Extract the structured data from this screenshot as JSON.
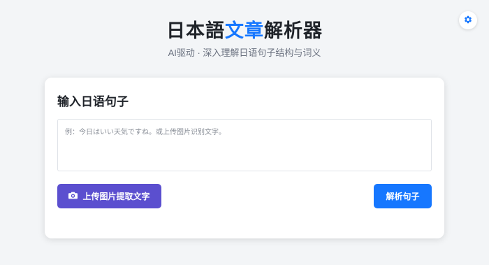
{
  "settings": {
    "icon": "gear-icon"
  },
  "header": {
    "title_part1": "日本語",
    "title_accent": "文章",
    "title_part2": "解析器",
    "subtitle": "AI驱动 · 深入理解日语句子结构与词义"
  },
  "input_card": {
    "heading": "输入日语句子",
    "placeholder": "例：今日はいい天気ですね。或上传图片识别文字。",
    "value": ""
  },
  "actions": {
    "upload_icon": "camera-icon",
    "upload_label": "上传图片提取文字",
    "parse_label": "解析句子"
  },
  "colors": {
    "accent": "#1677ff",
    "upload_button": "#5b4fcf",
    "background": "#f3f5f7"
  }
}
